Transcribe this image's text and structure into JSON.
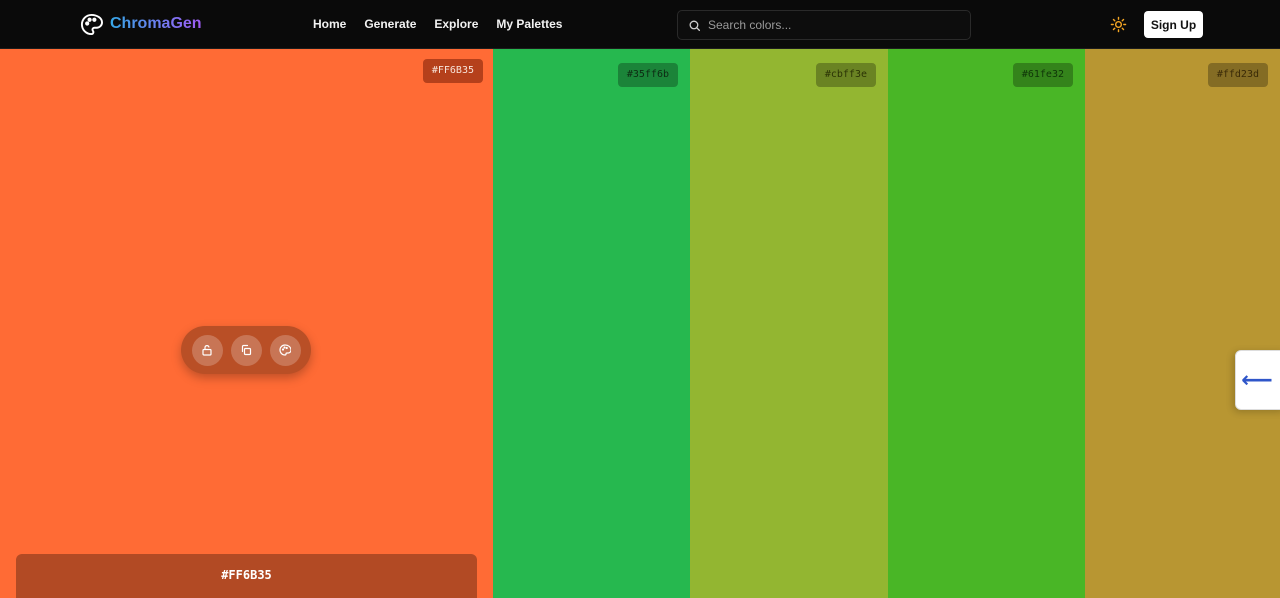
{
  "brand": {
    "name": "ChromaGen",
    "icon": "palette-icon"
  },
  "nav": {
    "links": [
      "Home",
      "Generate",
      "Explore",
      "My Palettes"
    ]
  },
  "search": {
    "placeholder": "Search colors...",
    "value": "",
    "icon": "search-icon"
  },
  "theme_toggle": {
    "icon": "sun-icon",
    "color": "#f5a623"
  },
  "signup_label": "Sign Up",
  "palette": {
    "swatches": [
      {
        "hex": "#FF6B35",
        "label": "#FF6B35",
        "color": "#ff6b35"
      },
      {
        "hex": "#35ff6b",
        "label": "#35ff6b",
        "color": "#26b84f"
      },
      {
        "hex": "#cbff3e",
        "label": "#cbff3e",
        "color": "#93b631"
      },
      {
        "hex": "#61fe32",
        "label": "#61fe32",
        "color": "#49b626"
      },
      {
        "hex": "#ffd23d",
        "label": "#ffd23d",
        "color": "#b89632"
      }
    ],
    "active_index": 0,
    "toolbar": {
      "icons": [
        "lock-open-icon",
        "copy-icon",
        "palette-icon"
      ]
    },
    "info_panel": {
      "hex": "#FF6B35",
      "subtext": ""
    }
  },
  "side_tab": {
    "icon": "arrow-left-icon",
    "glyph": "⟵"
  }
}
